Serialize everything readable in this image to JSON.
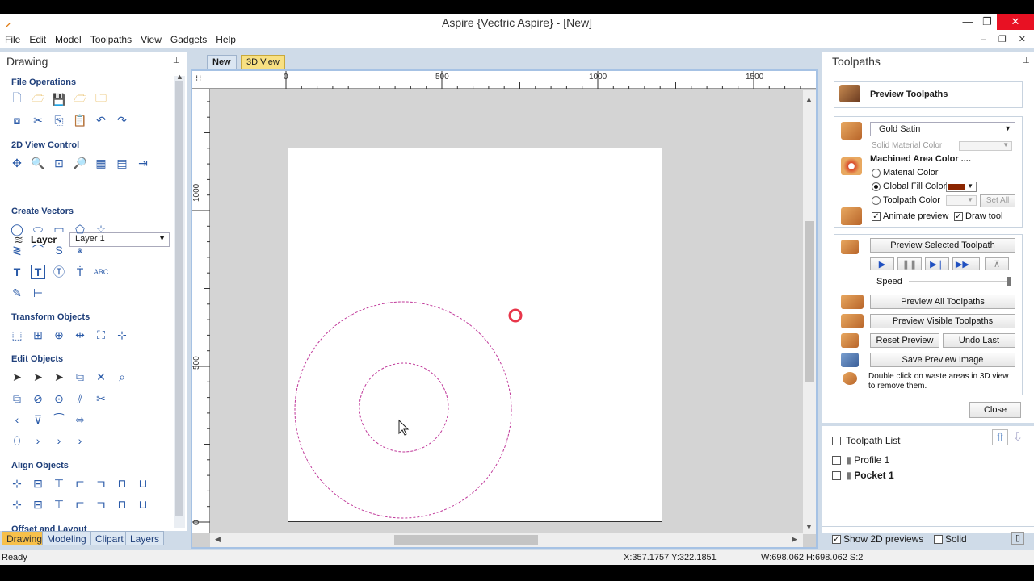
{
  "window": {
    "title": "Aspire {Vectric Aspire} - [New]",
    "minimize_glyph": "—",
    "maximize_glyph": "❐",
    "close_glyph": "✕"
  },
  "menu": [
    "File",
    "Edit",
    "Model",
    "Toolpaths",
    "View",
    "Gadgets",
    "Help"
  ],
  "mdi_controls": "– ❐ ✕",
  "left_panel": {
    "title": "Drawing",
    "sections": {
      "file_operations": "File Operations",
      "view_control": "2D View Control",
      "create_vectors": "Create Vectors",
      "transform_objects": "Transform Objects",
      "edit_objects": "Edit Objects",
      "align_objects": "Align Objects",
      "offset_layout": "Offset and Layout"
    },
    "layer_label": "Layer",
    "layer_value": "Layer 1",
    "tabs": [
      "Drawing",
      "Modeling",
      "Clipart",
      "Layers"
    ]
  },
  "doc_tabs": {
    "new": "New",
    "view3d": "3D View"
  },
  "rulers": {
    "h": [
      "0",
      "500",
      "1000",
      "1500"
    ],
    "v": [
      "1000",
      "500",
      "0"
    ]
  },
  "right_panel": {
    "title": "Toolpaths",
    "preview_header": "Preview Toolpaths",
    "material": "Gold Satin",
    "solid_material_color": "Solid Material Color",
    "machined_area_color": "Machined Area Color ....",
    "radio_material": "Material Color",
    "radio_global": "Global Fill Color",
    "radio_toolpath": "Toolpath Color",
    "set_all": "Set All",
    "animate_preview": "Animate preview",
    "draw_tool": "Draw tool",
    "preview_selected": "Preview Selected Toolpath",
    "speed": "Speed",
    "preview_all": "Preview All Toolpaths",
    "preview_visible": "Preview Visible Toolpaths",
    "reset_preview": "Reset Preview",
    "undo_last": "Undo Last",
    "save_preview_image": "Save Preview Image",
    "hint_line1": "Double click on waste areas in 3D view",
    "hint_line2": "to remove them.",
    "close": "Close",
    "toolpath_list": "Toolpath List",
    "toolpaths": [
      "Profile 1",
      "Pocket 1"
    ],
    "show_2d_previews": "Show 2D previews",
    "solid": "Solid"
  },
  "colors": {
    "global_fill": "#8b2500",
    "circle_stroke": "#c0399a",
    "tab_active": "#f7c04a"
  },
  "status": {
    "left": "Ready",
    "coords": "X:357.1757 Y:322.1851",
    "size": "W:698.062  H:698.062  S:2"
  }
}
